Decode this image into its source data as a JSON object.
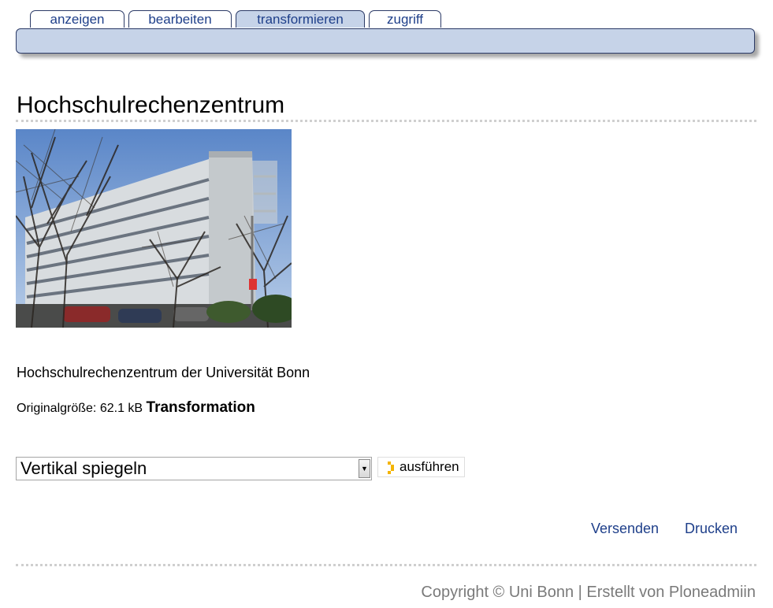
{
  "tabs": [
    {
      "label": "anzeigen",
      "active": false
    },
    {
      "label": "bearbeiten",
      "active": false
    },
    {
      "label": "transformieren",
      "active": true
    },
    {
      "label": "zugriff",
      "active": false
    }
  ],
  "page": {
    "title": "Hochschulrechenzentrum",
    "description": "Hochschulrechenzentrum der Universität Bonn",
    "original_size_label": "Originalgröße: 62.1 kB",
    "transformation_heading": "Transformation"
  },
  "transform": {
    "selected_option": "Vertikal spiegeln",
    "execute_label": "ausführen"
  },
  "actions": {
    "send": "Versenden",
    "print": "Drucken"
  },
  "footer": {
    "text": "Copyright © Uni Bonn | Erstellt von Ploneadmiin"
  },
  "colors": {
    "accent": "#c6d3e8",
    "link": "#1e3f8a",
    "footer": "#7a7a7a"
  }
}
